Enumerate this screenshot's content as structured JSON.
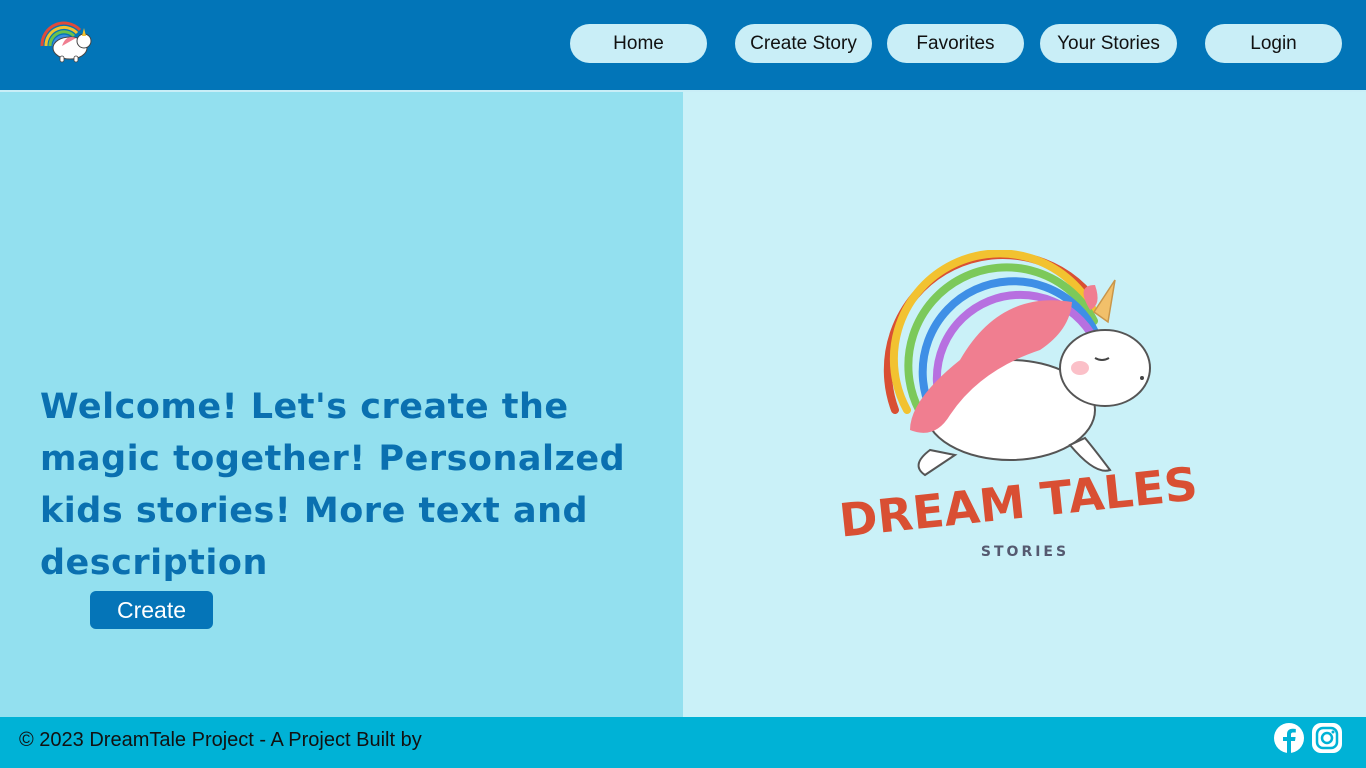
{
  "header": {
    "logo_icon": "unicorn-rainbow-logo-icon",
    "nav": [
      {
        "label": "Home"
      },
      {
        "label": "Create Story"
      },
      {
        "label": "Favorites"
      },
      {
        "label": "Your Stories"
      },
      {
        "label": "Login"
      }
    ]
  },
  "hero": {
    "headline": "Welcome! Let's create the magic together! Personalzed kids stories! More text and description",
    "cta_label": "Create"
  },
  "brand": {
    "logo_icon": "dream-tales-unicorn-logo",
    "title": "DREAM TALES",
    "subtitle": "STORIES"
  },
  "footer": {
    "copyright": "© 2023 DreamTale Project - A Project Built by",
    "social_icons": [
      "facebook-icon",
      "instagram-icon"
    ]
  },
  "colors": {
    "header_bg": "#0275b8",
    "nav_pill": "#c9eef7",
    "left_panel": "#93e0ef",
    "right_panel": "#caf1f8",
    "headline": "#0a70b0",
    "footer_bg": "#00b2d6",
    "brand_red": "#d94f33"
  }
}
